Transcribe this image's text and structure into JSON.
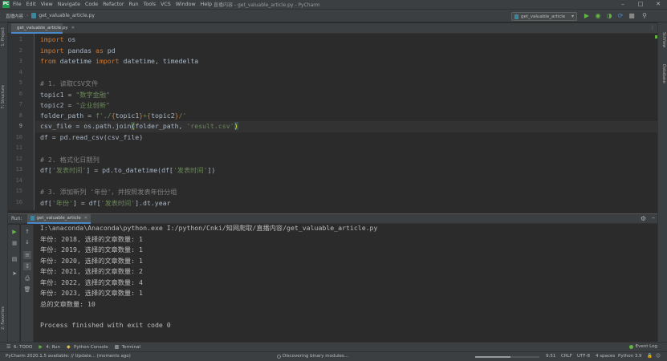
{
  "menubar": {
    "logo": "PC",
    "items": [
      "File",
      "Edit",
      "View",
      "Navigate",
      "Code",
      "Refactor",
      "Run",
      "Tools",
      "VCS",
      "Window",
      "Help"
    ],
    "title": "直播内容 - get_valuable_article.py - PyCharm"
  },
  "navbar": {
    "project": "直播内容",
    "file": "get_valuable_article.py",
    "run_config": "get_valuable_article"
  },
  "left_strip": {
    "project": "1: Project",
    "structure": "7: Structure",
    "favorites": "2: Favorites"
  },
  "right_strip": {
    "scview": "SciView",
    "database": "Database"
  },
  "editor_tab": {
    "label": "get_valuable_article.py"
  },
  "editor": {
    "current_line": 9,
    "line_numbers": [
      "1",
      "2",
      "3",
      "4",
      "5",
      "6",
      "7",
      "8",
      "9",
      "10",
      "11",
      "12",
      "13",
      "14",
      "15",
      "16"
    ]
  },
  "code": {
    "l1": {
      "kw": "import",
      "rest": " os"
    },
    "l2": {
      "kw": "import",
      "mid": " pandas ",
      "kw2": "as",
      "rest": " pd"
    },
    "l3": {
      "kw": "from",
      "mid": " datetime ",
      "kw2": "import",
      "rest": " datetime, timedelta"
    },
    "l5": "# 1. 读取CSV文件",
    "l6": {
      "var": "topic1 = ",
      "str": "\"数字金融\""
    },
    "l7": {
      "var": "topic2 = ",
      "str": "\"企业创新\""
    },
    "l8": {
      "var": "folder_path = ",
      "s1": "f'./",
      "b1": "{",
      "v1": "topic1",
      "b2": "}",
      "s2": "+",
      "b3": "{",
      "v2": "topic2",
      "b4": "}",
      "s3": "/'"
    },
    "l9": {
      "a": "csv_file = os.path.join",
      "p1": "(",
      "b": "folder_path, ",
      "str": "'result.csv'",
      "p2": ")"
    },
    "l10": "df = pd.read_csv(csv_file)",
    "l12": "# 2. 格式化日期列",
    "l13": {
      "a": "df[",
      "s1": "'发表时间'",
      "b": "] = pd.to_datetime(df[",
      "s2": "'发表时间'",
      "c": "])"
    },
    "l15": "# 3. 添加新列 '年份'，并按照发表年份分组",
    "l16": {
      "a": "df[",
      "s1": "'年份'",
      "b": "] = df[",
      "s2": "'发表时间'",
      "c": "].dt.year"
    }
  },
  "run_panel": {
    "label": "Run:",
    "tab": "get_valuable_article"
  },
  "console": {
    "lines": [
      "I:\\anaconda\\Anaconda\\python.exe I:/python/Cnki/知网爬取/直播内容/get_valuable_article.py",
      "年份: 2018, 选择的文章数量: 1",
      "年份: 2019, 选择的文章数量: 1",
      "年份: 2020, 选择的文章数量: 1",
      "年份: 2021, 选择的文章数量: 2",
      "年份: 2022, 选择的文章数量: 4",
      "年份: 2023, 选择的文章数量: 1",
      "总的文章数量: 10",
      "",
      "Process finished with exit code 0"
    ]
  },
  "bottom_tabs": {
    "todo": "6: TODO",
    "run": "4: Run",
    "python_console": "Python Console",
    "terminal": "Terminal",
    "event_log": "Event Log"
  },
  "statusbar": {
    "message": "PyCharm 2020.1.5 available: // Update... (moments ago)",
    "progress_label": "Discovering binary modules...",
    "progress": 0.55,
    "position": "9:51",
    "line_sep": "CRLF",
    "encoding": "UTF-8",
    "indent": "4 spaces",
    "interpreter": "Python 3.9"
  },
  "colors": {
    "accent": "#4a88c7",
    "run_green": "#62b543",
    "keyword": "#cc7832",
    "string": "#6a8759",
    "comment": "#808080"
  }
}
